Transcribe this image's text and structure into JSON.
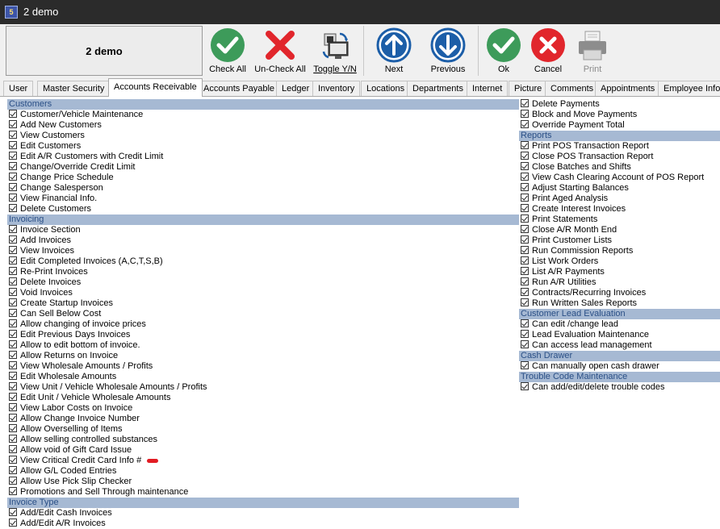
{
  "window": {
    "title": "2 demo",
    "app_icon": "app-logo-icon"
  },
  "toolbar": {
    "name": "2 demo",
    "check_all": "Check All",
    "uncheck_all": "Un-Check All",
    "toggle": "Toggle Y/N",
    "next": "Next",
    "previous": "Previous",
    "ok": "Ok",
    "cancel": "Cancel",
    "print": "Print"
  },
  "colors": {
    "section_bg": "#a6b9d3",
    "section_text": "#2a4f86",
    "check_green": "#3d9b5a",
    "cancel_red": "#e1262c",
    "nav_blue": "#1c5ea8"
  },
  "tabs": [
    "User",
    "Master Security",
    "Accounts Receivable",
    "Accounts Payable",
    "Ledger",
    "Inventory",
    "Locations",
    "Departments",
    "Internet",
    "Picture",
    "Comments",
    "Appointments",
    "Employee Info"
  ],
  "active_tab": "Accounts Receivable",
  "left": {
    "s0": {
      "title": "Customers",
      "items": [
        "Customer/Vehicle Maintenance",
        "Add New Customers",
        "View Customers",
        "Edit Customers",
        "Edit A/R Customers with Credit Limit",
        "Change/Override Credit Limit",
        "Change Price Schedule",
        "Change Salesperson",
        "View Financial Info.",
        "Delete Customers"
      ]
    },
    "s1": {
      "title": "Invoicing",
      "items": [
        "Invoice Section",
        "Add Invoices",
        "View Invoices",
        "Edit Completed  Invoices (A,C,T,S,B)",
        "Re-Print Invoices",
        "Delete Invoices",
        "Void Invoices",
        "Create Startup Invoices",
        "Can Sell Below Cost",
        "Allow changing of invoice prices",
        "Edit Previous Days Invoices",
        "Allow to edit bottom of invoice.",
        "Allow Returns on Invoice",
        "View Wholesale Amounts / Profits",
        "Edit Wholesale Amounts",
        "View Unit / Vehicle Wholesale Amounts / Profits",
        "Edit Unit / Vehicle Wholesale Amounts",
        "View Labor Costs on Invoice",
        "Allow Change Invoice Number",
        "Allow Overselling of Items",
        "Allow selling controlled substances",
        "Allow void of Gift Card Issue",
        "View Critical Credit Card Info #",
        "Allow G/L Coded Entries",
        "Allow Use Pick Slip Checker",
        "Promotions and Sell Through maintenance"
      ]
    },
    "s2": {
      "title": "Invoice Type",
      "items": [
        "Add/Edit Cash Invoices",
        "Add/Edit A/R Invoices"
      ]
    }
  },
  "right": {
    "top_items": [
      "Delete Payments",
      "Block and Move Payments",
      "Override Payment Total"
    ],
    "s0": {
      "title": "Reports",
      "items": [
        "Print POS Transaction Report",
        "Close POS Transaction Report",
        "Close Batches and Shifts",
        "View Cash Clearing Account of POS Report",
        "Adjust Starting Balances",
        "Print Aged Analysis",
        "Create Interest Invoices",
        "Print Statements",
        "Close A/R Month End",
        "Print Customer Lists",
        "Run Commission Reports",
        "List Work Orders",
        "List A/R Payments",
        "Run A/R Utilities",
        "Contracts/Recurring Invoices",
        "Run Written Sales Reports"
      ]
    },
    "s1": {
      "title": "Customer Lead Evaluation",
      "items": [
        "Can edit /change lead",
        "Lead Evaluation Maintenance",
        "Can access lead management"
      ]
    },
    "s2": {
      "title": "Cash Drawer",
      "items": [
        "Can manually open cash drawer"
      ]
    },
    "s3": {
      "title": "Trouble Code Maintenance",
      "items": [
        "Can add/edit/delete trouble codes"
      ]
    }
  }
}
